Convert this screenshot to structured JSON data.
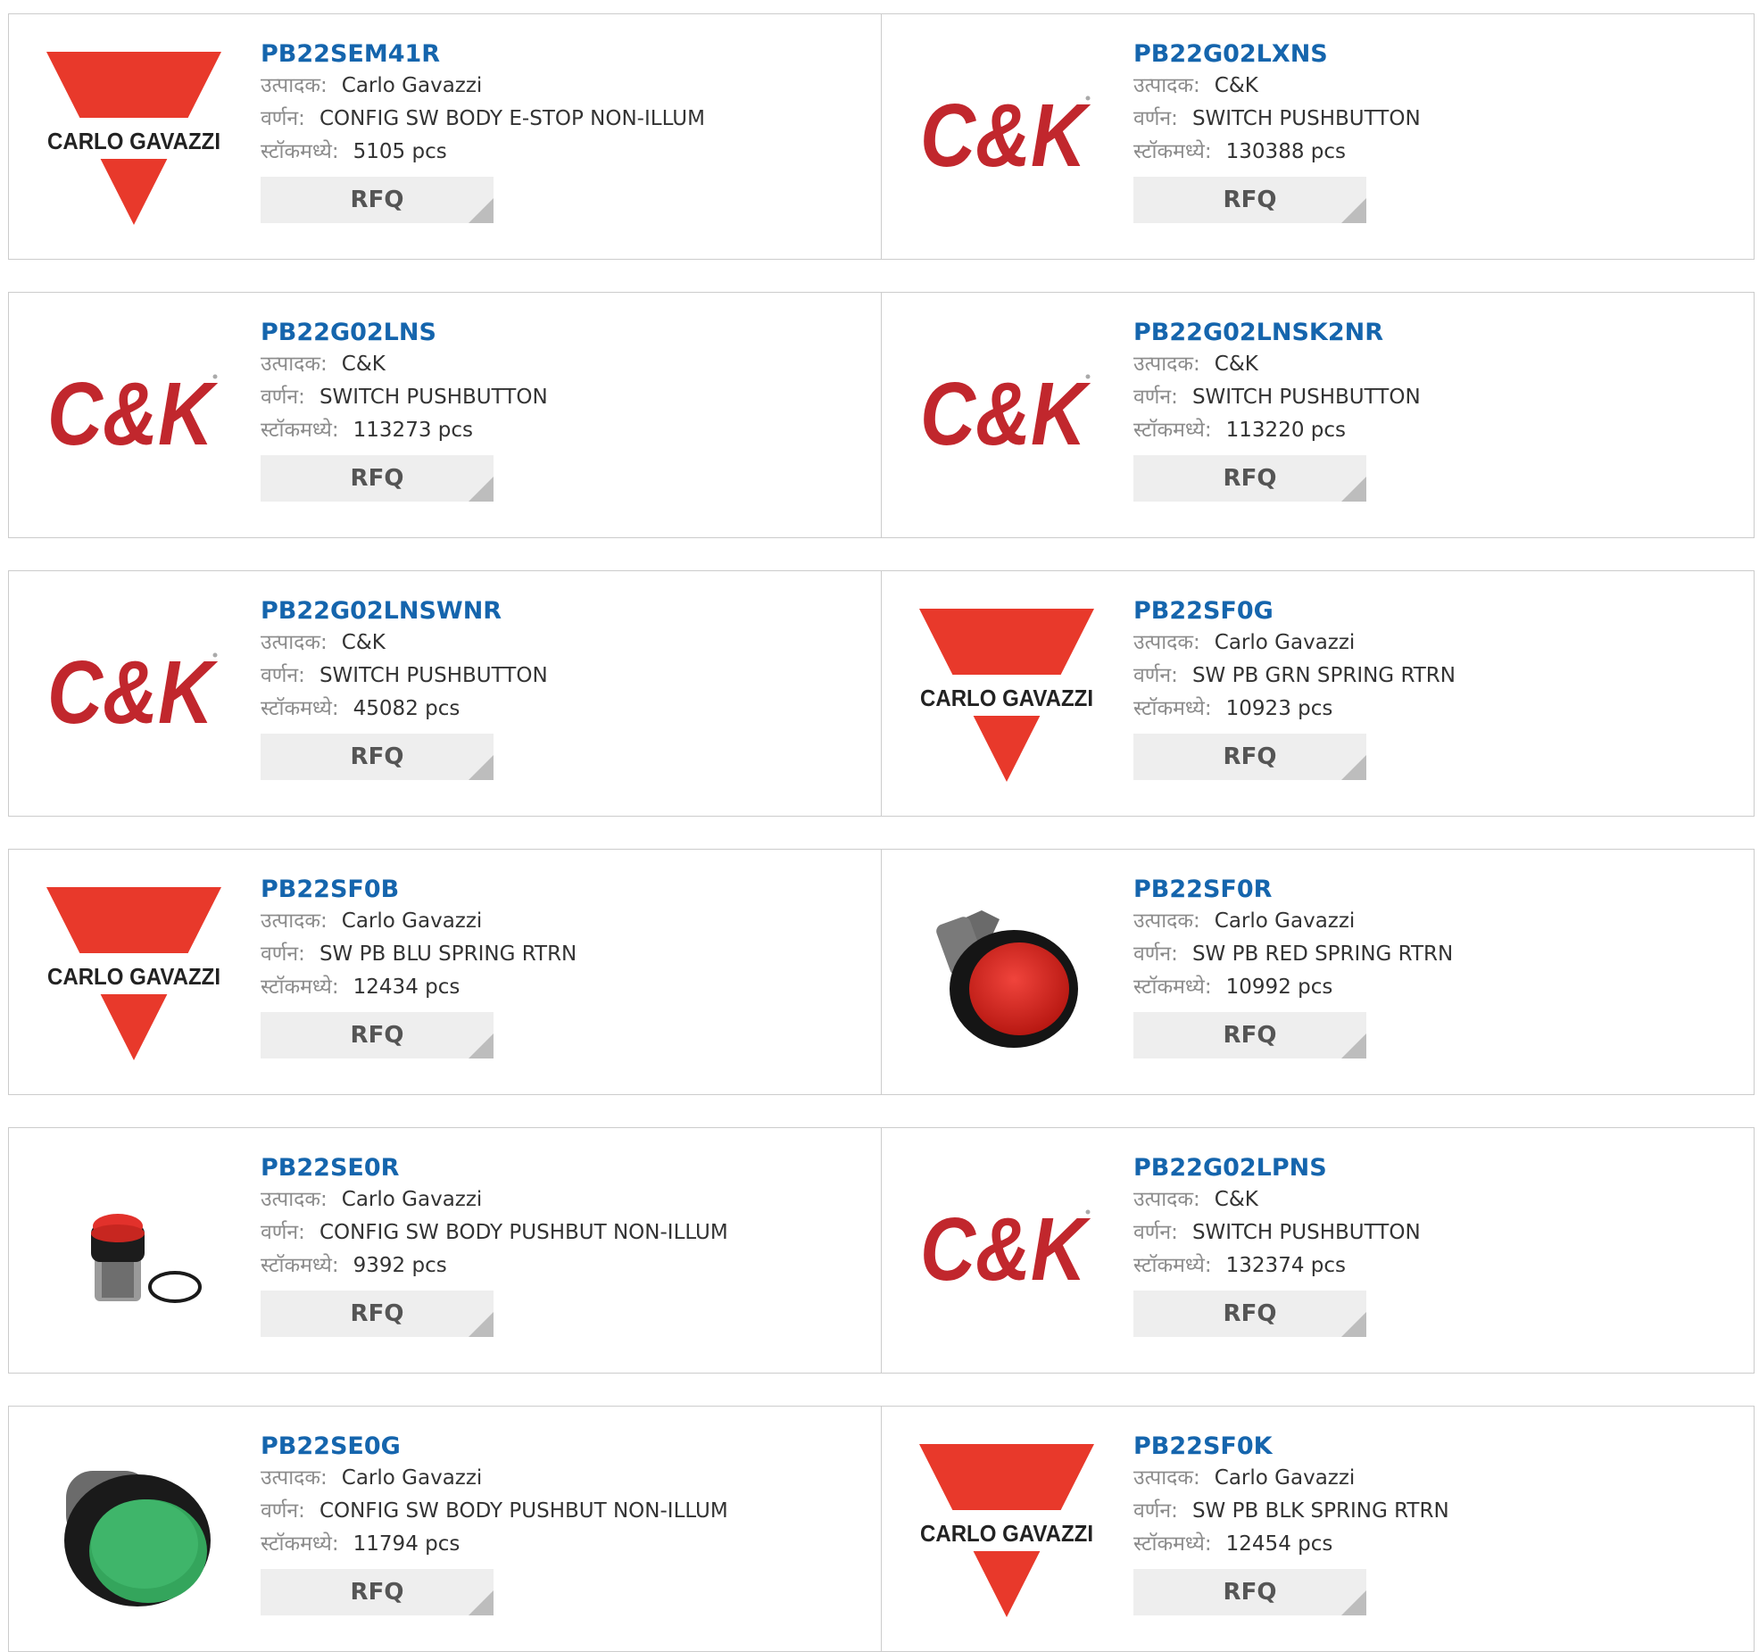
{
  "labels": {
    "manufacturer": "उत्पादक:",
    "description": "वर्णन:",
    "stock": "स्टॉकमध्ये:",
    "rfq": "RFQ"
  },
  "brand_colors": {
    "carlo_gavazzi_red": "#e8392b",
    "ck_red": "#c1272d",
    "link_blue": "#1565ad"
  },
  "products": [
    {
      "part": "PB22SEM41R",
      "manufacturer": "Carlo Gavazzi",
      "description": "CONFIG SW BODY E-STOP NON-ILLUM",
      "stock": "5105 pcs",
      "image": "carlo-gavazzi-logo",
      "logo_text": "CARLO GAVAZZI"
    },
    {
      "part": "PB22G02LXNS",
      "manufacturer": "C&K",
      "description": "SWITCH PUSHBUTTON",
      "stock": "130388 pcs",
      "image": "ck-logo",
      "logo_text": "C&K"
    },
    {
      "part": "PB22G02LNS",
      "manufacturer": "C&K",
      "description": "SWITCH PUSHBUTTON",
      "stock": "113273 pcs",
      "image": "ck-logo",
      "logo_text": "C&K"
    },
    {
      "part": "PB22G02LNSK2NR",
      "manufacturer": "C&K",
      "description": "SWITCH PUSHBUTTON",
      "stock": "113220 pcs",
      "image": "ck-logo",
      "logo_text": "C&K"
    },
    {
      "part": "PB22G02LNSWNR",
      "manufacturer": "C&K",
      "description": "SWITCH PUSHBUTTON",
      "stock": "45082 pcs",
      "image": "ck-logo",
      "logo_text": "C&K"
    },
    {
      "part": "PB22SF0G",
      "manufacturer": "Carlo Gavazzi",
      "description": "SW PB GRN SPRING RTRN",
      "stock": "10923 pcs",
      "image": "carlo-gavazzi-logo",
      "logo_text": "CARLO GAVAZZI"
    },
    {
      "part": "PB22SF0B",
      "manufacturer": "Carlo Gavazzi",
      "description": "SW PB BLU SPRING RTRN",
      "stock": "12434 pcs",
      "image": "carlo-gavazzi-logo",
      "logo_text": "CARLO GAVAZZI"
    },
    {
      "part": "PB22SF0R",
      "manufacturer": "Carlo Gavazzi",
      "description": "SW PB RED SPRING RTRN",
      "stock": "10992 pcs",
      "image": "red-pushbutton-photo"
    },
    {
      "part": "PB22SE0R",
      "manufacturer": "Carlo Gavazzi",
      "description": "CONFIG SW BODY PUSHBUT NON-ILLUM",
      "stock": "9392 pcs",
      "image": "red-pushbutton-body-photo"
    },
    {
      "part": "PB22G02LPNS",
      "manufacturer": "C&K",
      "description": "SWITCH PUSHBUTTON",
      "stock": "132374 pcs",
      "image": "ck-logo",
      "logo_text": "C&K"
    },
    {
      "part": "PB22SE0G",
      "manufacturer": "Carlo Gavazzi",
      "description": "CONFIG SW BODY PUSHBUT NON-ILLUM",
      "stock": "11794 pcs",
      "image": "green-pushbutton-photo"
    },
    {
      "part": "PB22SF0K",
      "manufacturer": "Carlo Gavazzi",
      "description": "SW PB BLK SPRING RTRN",
      "stock": "12454 pcs",
      "image": "carlo-gavazzi-logo",
      "logo_text": "CARLO GAVAZZI"
    }
  ]
}
